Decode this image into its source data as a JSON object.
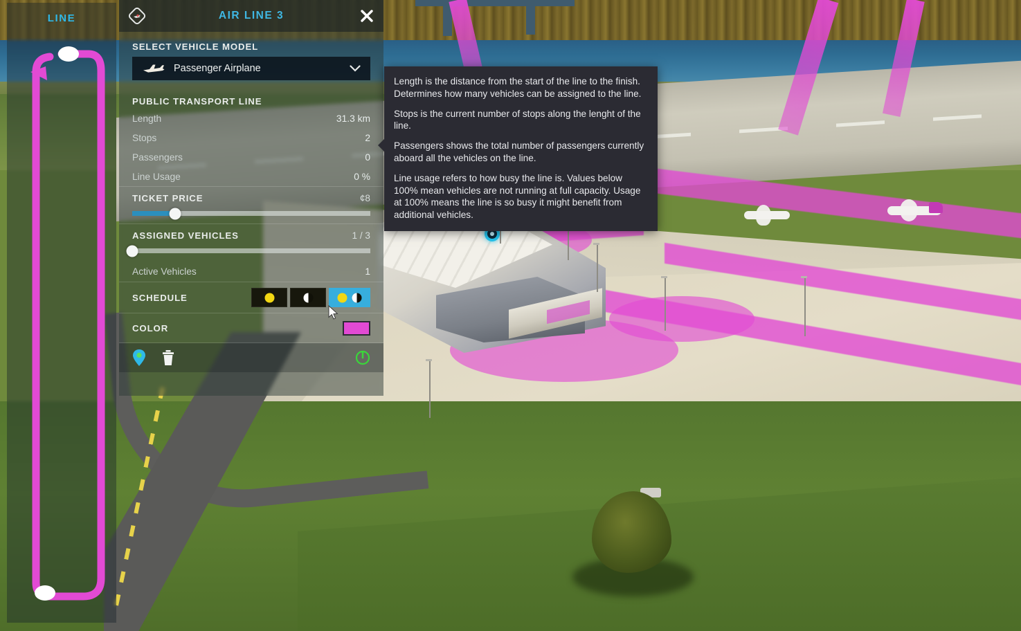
{
  "line_map_panel": {
    "title": "LINE",
    "route_color": "#e24ad4",
    "stops": 2
  },
  "panel": {
    "header": {
      "icon": "air-line-diamond-icon",
      "title": "AIR LINE 3",
      "close_icon": "close-icon"
    },
    "vehicle_model": {
      "section_label": "SELECT VEHICLE MODEL",
      "selected": "Passenger Airplane",
      "icon": "airplane-icon",
      "chevron": "chevron-down-icon"
    },
    "public_transport_line": {
      "section_label": "PUBLIC TRANSPORT LINE",
      "stats": [
        {
          "key": "Length",
          "value": "31.3 km"
        },
        {
          "key": "Stops",
          "value": "2"
        },
        {
          "key": "Passengers",
          "value": "0"
        },
        {
          "key": "Line Usage",
          "value": "0 %"
        }
      ]
    },
    "ticket_price": {
      "label": "TICKET PRICE",
      "value": "¢8",
      "fill_percent": 18,
      "accent_color": "#2b8fbd"
    },
    "assigned_vehicles": {
      "label": "ASSIGNED VEHICLES",
      "value": "1 / 3",
      "fill_percent": 0
    },
    "active_vehicles": {
      "key": "Active Vehicles",
      "value": "1"
    },
    "schedule": {
      "label": "SCHEDULE",
      "options": [
        {
          "name": "day",
          "icon": "sun-icon",
          "selected": false
        },
        {
          "name": "night",
          "icon": "moon-icon",
          "selected": false
        },
        {
          "name": "day-and-night",
          "icon": "sun-and-moon-icon",
          "selected": true
        }
      ],
      "selected_color": "#37aedd"
    },
    "color": {
      "label": "COLOR",
      "value": "#e24ad4"
    },
    "actions": [
      {
        "name": "follow-line-button",
        "icon": "map-pin-icon",
        "color": "#2fb9e8"
      },
      {
        "name": "delete-line-button",
        "icon": "trash-icon",
        "color": "#f2f3f2"
      },
      {
        "name": "toggle-line-active-button",
        "icon": "power-icon",
        "color": "#3ad63a"
      }
    ]
  },
  "tooltip": {
    "paragraphs": [
      "Length is the distance from the start of the line to the finish. Determines how many vehicles can be assigned to the line.",
      "Stops is the current number of stops along the lenght of the line.",
      "Passengers shows the total number of passengers currently aboard all the vehicles on the line.",
      "Line usage refers to how busy the line is. Values below 100% mean vehicles are not running at full capacity. Usage at 100% means the line is so busy it might benefit from additional vehicles."
    ]
  }
}
